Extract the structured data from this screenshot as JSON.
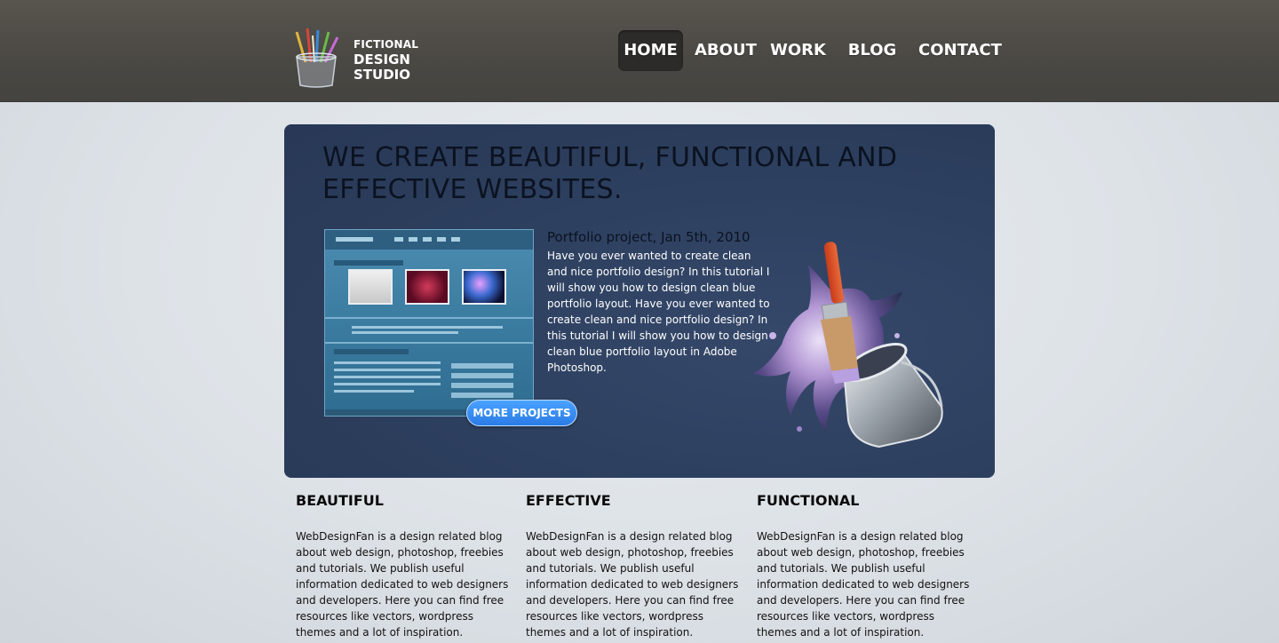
{
  "logo": {
    "line1": "FICTIONAL",
    "line2": "DESIGN",
    "line3": "STUDIO",
    "icon": "pencil-cup-icon"
  },
  "nav": {
    "items": [
      {
        "label": "HOME",
        "active": true
      },
      {
        "label": "ABOUT",
        "active": false
      },
      {
        "label": "WORK",
        "active": false
      },
      {
        "label": "BLOG",
        "active": false
      },
      {
        "label": "CONTACT",
        "active": false
      }
    ]
  },
  "hero": {
    "title": "WE CREATE BEAUTIFUL, FUNCTIONAL AND EFFECTIVE WEBSITES.",
    "project_title": "Portfolio project, Jan 5th, 2010",
    "project_desc": "Have you ever wanted to create clean and nice portfolio design? In this tutorial I will show you how to design clean blue portfolio layout. Have you ever wanted to create clean and nice portfolio design? In this tutorial I will show you how to design clean blue portfolio layout in Adobe Photoshop.",
    "more_button": "MORE PROJECTS",
    "art_icon": "paintbrush-bucket-icon"
  },
  "features": [
    {
      "title": "BEAUTIFUL",
      "text": "WebDesignFan is a design related blog about web design, photoshop, freebies and tutorials. We publish useful information dedicated to web designers and developers. Here you can find free resources like vectors, wordpress themes and a lot of inspiration."
    },
    {
      "title": "EFFECTIVE",
      "text": "WebDesignFan is a design related blog about web design, photoshop, freebies and tutorials. We publish useful information dedicated to web designers and developers. Here you can find free resources like vectors, wordpress themes and a lot of inspiration."
    },
    {
      "title": "FUNCTIONAL",
      "text": "WebDesignFan is a design related blog about web design, photoshop, freebies and tutorials. We publish useful information dedicated to web designers and developers. Here you can find free resources like vectors, wordpress themes and a lot of inspiration."
    }
  ],
  "colors": {
    "header_bg": "#4a4843",
    "hero_bg": "#2d3f5e",
    "button_blue": "#2b7be6",
    "page_bg": "#e1e5ea"
  }
}
